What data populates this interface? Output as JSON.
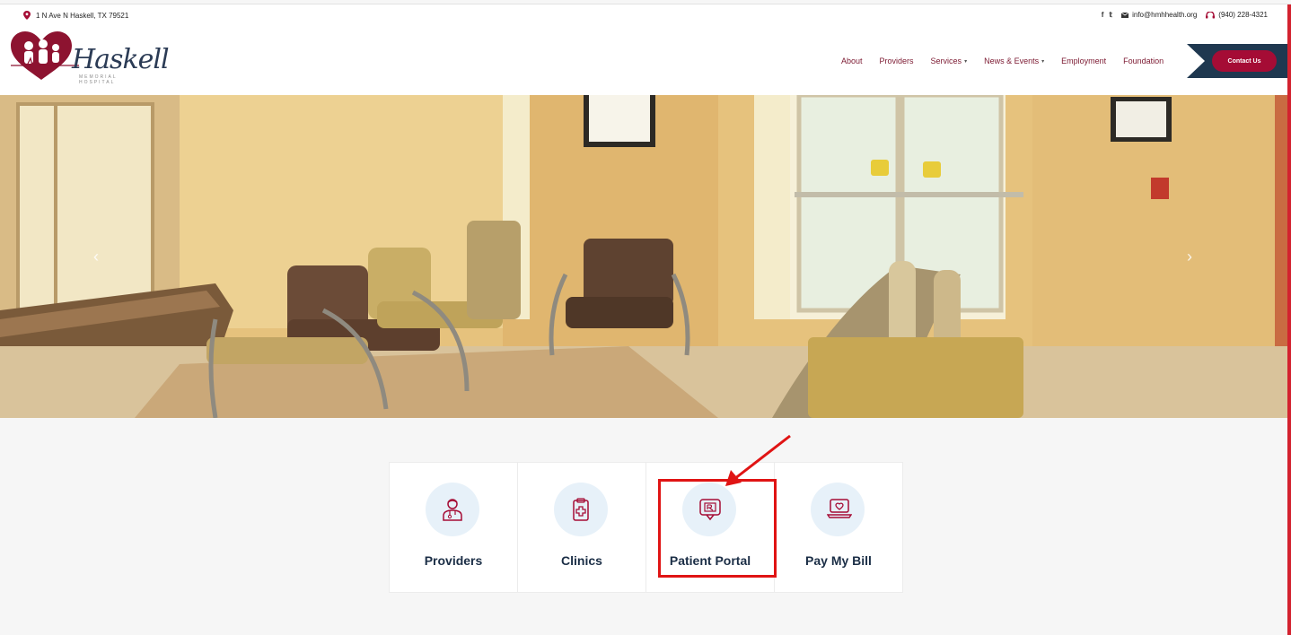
{
  "topbar": {
    "address": "1 N Ave N Haskell, TX 79521",
    "social": [
      "f",
      "𝕥"
    ],
    "email": "info@hmhhealth.org",
    "phone": "(940) 228-4321"
  },
  "logo": {
    "name": "Haskell",
    "subtitle": "MEMORIAL HOSPITAL"
  },
  "nav": {
    "items": [
      {
        "label": "About",
        "has_dropdown": false
      },
      {
        "label": "Providers",
        "has_dropdown": false
      },
      {
        "label": "Services",
        "has_dropdown": true
      },
      {
        "label": "News & Events",
        "has_dropdown": true
      },
      {
        "label": "Employment",
        "has_dropdown": false
      },
      {
        "label": "Foundation",
        "has_dropdown": false
      }
    ],
    "cta_label": "Contact Us"
  },
  "hero": {
    "prev": "‹",
    "next": "›"
  },
  "quick_links": [
    {
      "label": "Providers",
      "icon": "doctor-icon"
    },
    {
      "label": "Clinics",
      "icon": "clipboard-medical-icon"
    },
    {
      "label": "Patient Portal",
      "icon": "prescription-chat-icon"
    },
    {
      "label": "Pay My Bill",
      "icon": "laptop-heart-icon"
    }
  ],
  "colors": {
    "brand_maroon": "#a50c35",
    "navy": "#1f3850",
    "nav_text": "#7b1830",
    "annotation_red": "#e01414"
  }
}
